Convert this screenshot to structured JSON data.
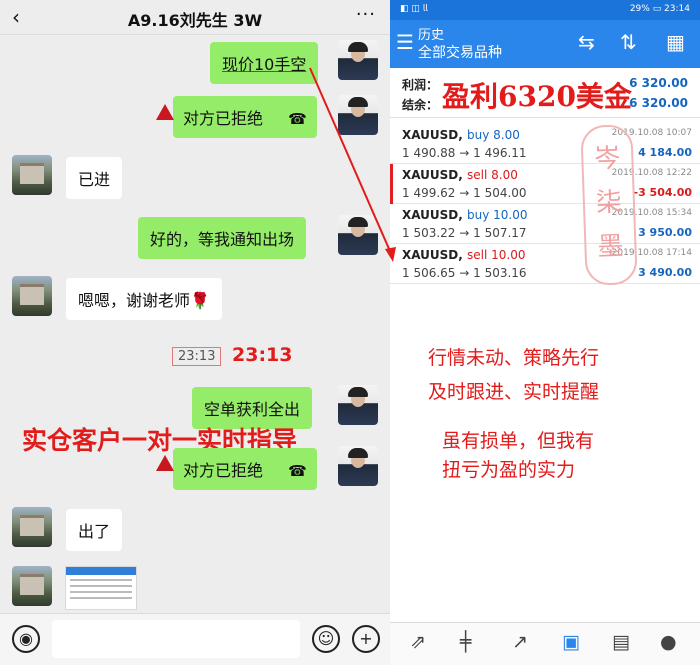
{
  "chat": {
    "header": {
      "back": "‹",
      "title": "A9.16刘先生 3W",
      "more": "···"
    },
    "messages": [
      {
        "text": "现价10手空"
      },
      {
        "text": "对方已拒绝"
      },
      {
        "text": "已进"
      },
      {
        "text": "好的，等我通知出场"
      },
      {
        "text": "嗯嗯，谢谢老师🌹"
      },
      {
        "text": "空单获利全出"
      },
      {
        "text": "对方已拒绝"
      },
      {
        "text": "出了"
      }
    ],
    "time_chip": "23:13",
    "time_red": "23:13",
    "overlay_slogan": "实仓客户一对一实时指导",
    "input_bar": {
      "voice_icon": "◉",
      "emoji_icon": "☺",
      "plus_icon": "+"
    }
  },
  "trade": {
    "status_bar": {
      "left": "◧ ◫ 𝗅𝗅",
      "right": "29% ▭ 23:14"
    },
    "app_bar": {
      "title": "历史",
      "subtitle": "全部交易品种"
    },
    "summary": {
      "profit_label": "利润：",
      "profit_value": "6 320.00",
      "balance_label": "结余：",
      "balance_value": "6 320.00"
    },
    "overlay_profit": "盈利6320美金",
    "trades": [
      {
        "symbol": "XAUUSD,",
        "side": "buy 8.00",
        "prices": "1 490.88 → 1 496.11",
        "date": "2019.10.08 10:07",
        "pl": "4 184.00",
        "positive": true
      },
      {
        "symbol": "XAUUSD,",
        "side": "sell 8.00",
        "prices": "1 499.62 → 1 504.00",
        "date": "2019.10.08 12:22",
        "pl": "-3 504.00",
        "positive": false
      },
      {
        "symbol": "XAUUSD,",
        "side": "buy 10.00",
        "prices": "1 503.22 → 1 507.17",
        "date": "2019.10.08 15:34",
        "pl": "3 950.00",
        "positive": true
      },
      {
        "symbol": "XAUUSD,",
        "side": "sell 10.00",
        "prices": "1 506.65 → 1 503.16",
        "date": "2019.10.08 17:14",
        "pl": "3 490.00",
        "positive": true
      }
    ],
    "stamp": "岑柒墨",
    "slogans": [
      "行情未动、策略先行",
      "及时跟进、实时提醒",
      "虽有损单，但我有",
      "扭亏为盈的实力"
    ]
  },
  "colors": {
    "chat_green": "#95ec69",
    "accent_red": "#e21b1b",
    "mt_blue": "#2a86ea"
  }
}
